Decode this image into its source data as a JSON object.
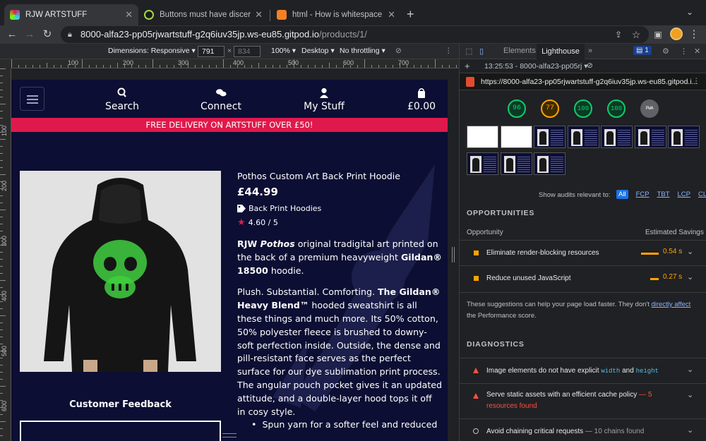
{
  "browser": {
    "tabs": [
      {
        "title": "RJW ARTSTUFF",
        "active": true
      },
      {
        "title": "Buttons must have discernible",
        "active": false
      },
      {
        "title": "html - How is whitespace in an",
        "active": false
      }
    ],
    "new_tab_symbol": "+",
    "omnibox": {
      "host": "8000-alfa23-pp05rjwartstuff-g2q6iuv35jp.ws-eu85.gitpod.io",
      "path": "/products/1/"
    }
  },
  "device_toolbar": {
    "dimensions": "Dimensions: Responsive",
    "width": "791",
    "height": "834",
    "zoom": "100%",
    "device": "Desktop",
    "throttle": "No throttling"
  },
  "ruler": {
    "h_labels": [
      "100",
      "200",
      "300",
      "400",
      "500",
      "600",
      "700"
    ],
    "v_labels": [
      "100",
      "200",
      "300",
      "400",
      "500",
      "600"
    ]
  },
  "site": {
    "nav": [
      {
        "label": "Search",
        "icon": "search-icon"
      },
      {
        "label": "Connect",
        "icon": "chat-icon"
      },
      {
        "label": "My Stuff",
        "icon": "user-icon"
      },
      {
        "label": "£0.00",
        "icon": "bag-icon"
      }
    ],
    "banner": "FREE DELIVERY ON ARTSTUFF OVER £50!",
    "product": {
      "title": "Pothos Custom Art Back Print Hoodie",
      "price": "£44.99",
      "category": "Back Print Hoodies",
      "rating": "4.60 / 5",
      "desc1_a": "RJW ",
      "desc1_b": "Pothos",
      "desc1_c": " original tradigital art printed on the back of a premium heavyweight ",
      "desc1_d": "Gildan® 18500",
      "desc1_e": " hoodie.",
      "desc2_a": "Plush. Substantial. Comforting. ",
      "desc2_b": "The Gildan® Heavy Blend™",
      "desc2_c": " hooded sweatshirt is all these things and much more. Its 50% cotton, 50% polyester fleece is brushed to downy-soft perfection inside. Outside, the dense and pill-resistant face serves as the perfect surface for our dye sublimation print process. The angular pouch pocket gives it an updated attitude, and a double-layer hood tops it off in cosy style.",
      "bullet": "Spun yarn for a softer feel and reduced"
    },
    "feedback_heading": "Customer Feedback"
  },
  "devtools": {
    "tabs": [
      "Elements",
      "Lighthouse"
    ],
    "issues_count": "1",
    "report_time": "13:25:53 - 8000-alfa23-pp05rj",
    "report_url": "https://8000-alfa23-pp05rjwartstuff-g2q6iuv35jp.ws-eu85.gitpod.i...",
    "scores": [
      {
        "value": "96",
        "color": "#0cce6b"
      },
      {
        "value": "77",
        "color": "#ffa400"
      },
      {
        "value": "100",
        "color": "#0cce6b"
      },
      {
        "value": "100",
        "color": "#0cce6b"
      },
      {
        "value": "PWA",
        "color": "#9aa0a6"
      }
    ],
    "filter_label": "Show audits relevant to:",
    "filters": [
      "All",
      "FCP",
      "TBT",
      "LCP",
      "CLS"
    ],
    "opportunities_heading": "OPPORTUNITIES",
    "opportunity_col": "Opportunity",
    "savings_col": "Estimated Savings",
    "opportunities": [
      {
        "text": "Eliminate render-blocking resources",
        "saving": "0.54 s",
        "fraction": 0.54
      },
      {
        "text": "Reduce unused JavaScript",
        "saving": "0.27 s",
        "fraction": 0.27
      }
    ],
    "suggest_a": "These suggestions can help your page load faster. They don't ",
    "suggest_link": "directly affect",
    "suggest_b": " the Performance score.",
    "diagnostics_heading": "DIAGNOSTICS",
    "diag1_a": "Image elements do not have explicit ",
    "diag1_code1": "width",
    "diag1_and": " and ",
    "diag1_code2": "height",
    "diag2_a": "Serve static assets with an efficient cache policy",
    "diag2_b": " — 5 resources found",
    "diag3_a": "Avoid chaining critical requests",
    "diag3_b": " — 10 chains found"
  }
}
